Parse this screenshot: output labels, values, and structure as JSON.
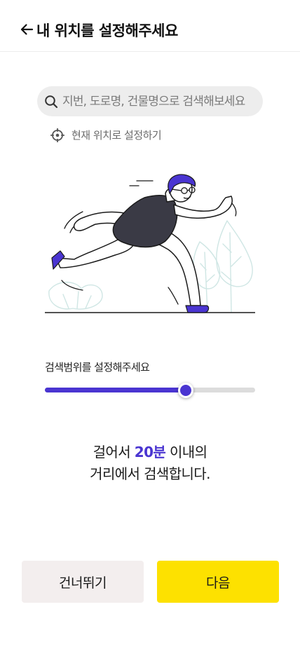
{
  "header": {
    "back_icon": "arrow-left-icon",
    "title": "내 위치를 설정해주세요"
  },
  "search": {
    "icon": "search-icon",
    "placeholder": "지번, 도로명, 건물명으로 검색해보세요",
    "value": ""
  },
  "current_location": {
    "icon": "crosshair-icon",
    "label": "현재 위치로 설정하기"
  },
  "illustration": {
    "subject": "running-person-illustration"
  },
  "range": {
    "label": "검색범위를 설정해주세요",
    "slider_level": 0.67
  },
  "result": {
    "prefix": "걸어서 ",
    "highlight": "20분",
    "suffix": " 이내의",
    "line2": "거리에서 검색합니다."
  },
  "buttons": {
    "skip_label": "건너뛰기",
    "next_label": "다음"
  },
  "colors": {
    "accent": "#4a35d1",
    "primary_button": "#fde100",
    "secondary_button": "#f3eeee",
    "search_bg": "#ededed"
  }
}
